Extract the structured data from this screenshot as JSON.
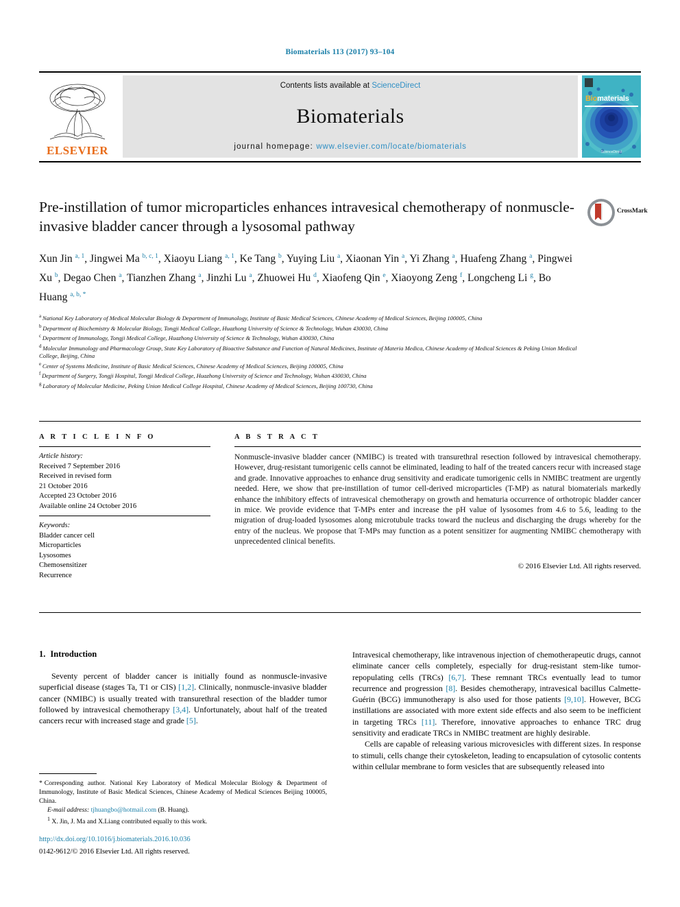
{
  "running_head": "Biomaterials 113 (2017) 93–104",
  "masthead": {
    "publisher": "ELSEVIER",
    "contents_prefix": "Contents lists available at ",
    "contents_link": "ScienceDirect",
    "journal_title": "Biomaterials",
    "homepage_label": "journal homepage: ",
    "homepage_url": "www.elsevier.com/locate/biomaterials",
    "cover_title_b": "Bio",
    "cover_title_rest": "materials",
    "cover_footer": "ScienceDirect"
  },
  "crossmark": {
    "label": "CrossMark"
  },
  "article": {
    "title": "Pre-instillation of tumor microparticles enhances intravesical chemotherapy of nonmuscle-invasive bladder cancer through a lysosomal pathway",
    "authors": [
      {
        "name": "Xun Jin",
        "sup": "a, 1"
      },
      {
        "name": "Jingwei Ma",
        "sup": "b, c, 1"
      },
      {
        "name": "Xiaoyu Liang",
        "sup": "a, 1"
      },
      {
        "name": "Ke Tang",
        "sup": "b"
      },
      {
        "name": "Yuying Liu",
        "sup": "a"
      },
      {
        "name": "Xiaonan Yin",
        "sup": "a"
      },
      {
        "name": "Yi Zhang",
        "sup": "a"
      },
      {
        "name": "Huafeng Zhang",
        "sup": "a"
      },
      {
        "name": "Pingwei Xu",
        "sup": "b"
      },
      {
        "name": "Degao Chen",
        "sup": "a"
      },
      {
        "name": "Tianzhen Zhang",
        "sup": "a"
      },
      {
        "name": "Jinzhi Lu",
        "sup": "a"
      },
      {
        "name": "Zhuowei Hu",
        "sup": "d"
      },
      {
        "name": "Xiaofeng Qin",
        "sup": "e"
      },
      {
        "name": "Xiaoyong Zeng",
        "sup": "f"
      },
      {
        "name": "Longcheng Li",
        "sup": "g"
      },
      {
        "name": "Bo Huang",
        "sup": "a, b, *"
      }
    ],
    "affiliations": [
      {
        "key": "a",
        "text": "National Key Laboratory of Medical Molecular Biology & Department of Immunology, Institute of Basic Medical Sciences, Chinese Academy of Medical Sciences, Beijing 100005, China"
      },
      {
        "key": "b",
        "text": "Department of Biochemistry & Molecular Biology, Tongji Medical College, Huazhong University of Science & Technology, Wuhan 430030, China"
      },
      {
        "key": "c",
        "text": "Department of Immunology, Tongji Medical College, Huazhong University of Science & Technology, Wuhan 430030, China"
      },
      {
        "key": "d",
        "text": "Molecular Immunology and Pharmacology Group, State Key Laboratory of Bioactive Substance and Function of Natural Medicines, Institute of Materia Medica, Chinese Academy of Medical Sciences & Peking Union Medical College, Beijing, China"
      },
      {
        "key": "e",
        "text": "Center of Systems Medicine, Institute of Basic Medical Sciences, Chinese Academy of Medical Sciences, Beijing 100005, China"
      },
      {
        "key": "f",
        "text": "Department of Surgery, Tongji Hospital, Tongji Medical College, Huazhong University of Science and Technology, Wuhan 430030, China"
      },
      {
        "key": "g",
        "text": "Laboratory of Molecular Medicine, Peking Union Medical College Hospital, Chinese Academy of Medical Sciences, Beijing 100730, China"
      }
    ]
  },
  "article_info": {
    "heading": "A R T I C L E   I N F O",
    "history_label": "Article history:",
    "history": [
      "Received 7 September 2016",
      "Received in revised form",
      "21 October 2016",
      "Accepted 23 October 2016",
      "Available online 24 October 2016"
    ],
    "keywords_label": "Keywords:",
    "keywords": [
      "Bladder cancer cell",
      "Microparticles",
      "Lysosomes",
      "Chemosensitizer",
      "Recurrence"
    ]
  },
  "abstract": {
    "heading": "A B S T R A C T",
    "text": "Nonmuscle-invasive bladder cancer (NMIBC) is treated with transurethral resection followed by intravesical chemotherapy. However, drug-resistant tumorigenic cells cannot be eliminated, leading to half of the treated cancers recur with increased stage and grade. Innovative approaches to enhance drug sensitivity and eradicate tumorigenic cells in NMIBC treatment are urgently needed. Here, we show that pre-instillation of tumor cell-derived microparticles (T-MP) as natural biomaterials markedly enhance the inhibitory effects of intravesical chemotherapy on growth and hematuria occurrence of orthotropic bladder cancer in mice. We provide evidence that T-MPs enter and increase the pH value of lysosomes from 4.6 to 5.6, leading to the migration of drug-loaded lysosomes along microtubule tracks toward the nucleus and discharging the drugs whereby for the entry of the nucleus. We propose that T-MPs may function as a potent sensitizer for augmenting NMIBC chemotherapy with unprecedented clinical benefits.",
    "copyright": "© 2016 Elsevier Ltd. All rights reserved."
  },
  "introduction": {
    "number": "1.",
    "heading": "Introduction",
    "left_paragraph_parts": [
      "Seventy percent of bladder cancer is initially found as nonmuscle-invasive superficial disease (stages Ta, T1 or CIS) ",
      "[1,2]",
      ". Clinically, nonmuscle-invasive bladder cancer (NMIBC) is usually treated with transurethral resection of the bladder tumor followed by intravesical chemotherapy ",
      "[3,4]",
      ". Unfortunately, about half of the treated cancers recur with increased stage and grade ",
      "[5]",
      "."
    ],
    "right_paragraph_parts": [
      "Intravesical chemotherapy, like intravenous injection of chemotherapeutic drugs, cannot eliminate cancer cells completely, especially for drug-resistant stem-like tumor-repopulating cells (TRCs) ",
      "[6,7]",
      ". These remnant TRCs eventually lead to tumor recurrence and progression ",
      "[8]",
      ". Besides chemotherapy, intravesical bacillus Calmette-Guérin (BCG) immunotherapy is also used for those patients ",
      "[9,10]",
      ". However, BCG instillations are associated with more extent side effects and also seem to be inefficient in targeting TRCs ",
      "[11]",
      ". Therefore, innovative approaches to enhance TRC drug sensitivity and eradicate TRCs in NMIBC treatment are highly desirable."
    ],
    "right_paragraph_2": "Cells are capable of releasing various microvesicles with different sizes. In response to stimuli, cells change their cytoskeleton, leading to encapsulation of cytosolic contents within cellular membrane to form vesicles that are subsequently released into"
  },
  "footnotes": {
    "corresponding_mark": "*",
    "corresponding": "Corresponding author. National Key Laboratory of Medical Molecular Biology & Department of Immunology, Institute of Basic Medical Sciences, Chinese Academy of Medical Sciences Beijing 100005, China.",
    "email_label": "E-mail address:",
    "email": "tjhuangbo@hotmail.com",
    "email_owner": "(B. Huang).",
    "equal_mark": "1",
    "equal_contrib": "X. Jin, J. Ma and X.Liang contributed equally to this work."
  },
  "footer": {
    "doi": "http://dx.doi.org/10.1016/j.biomaterials.2016.10.036",
    "issn_line": "0142-9612/© 2016 Elsevier Ltd. All rights reserved."
  },
  "colors": {
    "link": "#1a7fa8",
    "sciencedirect": "#2f8fc4",
    "elsevier_orange": "#E86C1A",
    "cover_teal": "#3fb3c4",
    "cover_blue": "#1b3fa0"
  }
}
